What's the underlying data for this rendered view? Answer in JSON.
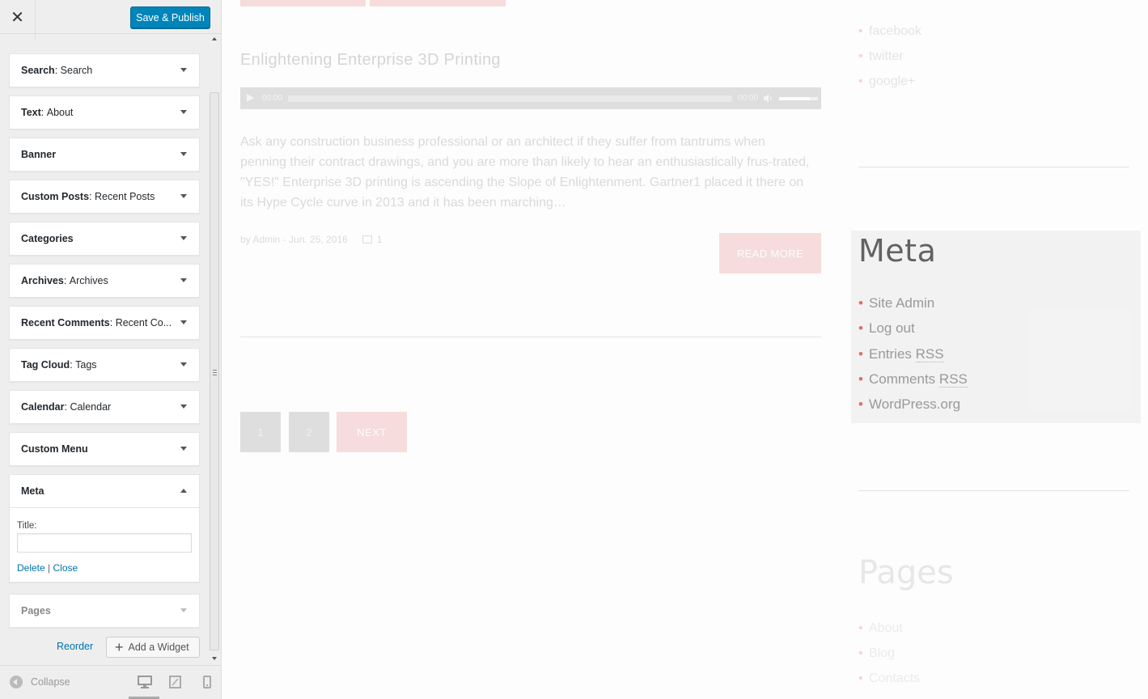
{
  "header": {
    "close_symbol": "✕",
    "save_label": "Save & Publish"
  },
  "widgets": [
    {
      "type": "Search",
      "title": "Search"
    },
    {
      "type": "Text",
      "title": "About"
    },
    {
      "type": "Banner",
      "title": ""
    },
    {
      "type": "Custom Posts",
      "title": "Recent Posts"
    },
    {
      "type": "Categories",
      "title": ""
    },
    {
      "type": "Archives",
      "title": "Archives"
    },
    {
      "type": "Recent Comments",
      "title": "Recent Co..."
    },
    {
      "type": "Tag Cloud",
      "title": "Tags"
    },
    {
      "type": "Calendar",
      "title": "Calendar"
    },
    {
      "type": "Custom Menu",
      "title": ""
    },
    {
      "type": "Meta",
      "title": ""
    },
    {
      "type": "Pages",
      "title": ""
    }
  ],
  "meta_form": {
    "title_label": "Title:",
    "title_value": "",
    "delete_label": "Delete",
    "separator": "|",
    "close_label": "Close"
  },
  "footer_actions": {
    "reorder_label": "Reorder",
    "add_widget_label": "Add a Widget",
    "collapse_label": "Collapse"
  },
  "icons": {
    "close": "close-icon",
    "plus": "plus-icon",
    "collapse": "collapse-icon",
    "desktop": "desktop-icon",
    "tablet": "tablet-icon",
    "mobile": "mobile-icon",
    "play": "play-icon",
    "mute": "volume-icon",
    "comment": "comment-icon"
  },
  "colors": {
    "primary_button": "#0085ba",
    "accent_pink": "#f5cccd",
    "meta_bullet": "#cc2222"
  },
  "preview": {
    "social_links": [
      "facebook",
      "twitter",
      "google+"
    ],
    "post": {
      "title": "Enlightening Enterprise 3D Printing",
      "audio_time_current": "00:00",
      "audio_time_duration": "00:00",
      "audio_volume": 0.8,
      "excerpt": "Ask any construction business professional or an architect if they suffer from tantrums when penning their contract drawings, and you are more than likely to hear an enthusiastically frus-trated, \"YES!\" Enterprise 3D printing is ascending the Slope of Enlightenment. Gartner1 placed it there on its Hype Cycle curve in 2013 and it has been marching…",
      "meta_text": "by Admin - Jun. 25, 2016",
      "comment_count": "1",
      "read_more_label": "READ MORE"
    },
    "pagination": {
      "page1": "1",
      "page2": "2",
      "next_label": "NEXT"
    },
    "meta_widget": {
      "heading": "Meta",
      "site_admin": "Site Admin",
      "log_out": "Log out",
      "entries_prefix": "Entries ",
      "entries_abbr": "RSS",
      "comments_prefix": "Comments ",
      "comments_abbr": "RSS",
      "wordpress_org": "WordPress.org"
    },
    "pages_widget": {
      "heading": "Pages",
      "items": [
        "About",
        "Blog",
        "Contacts"
      ]
    }
  }
}
